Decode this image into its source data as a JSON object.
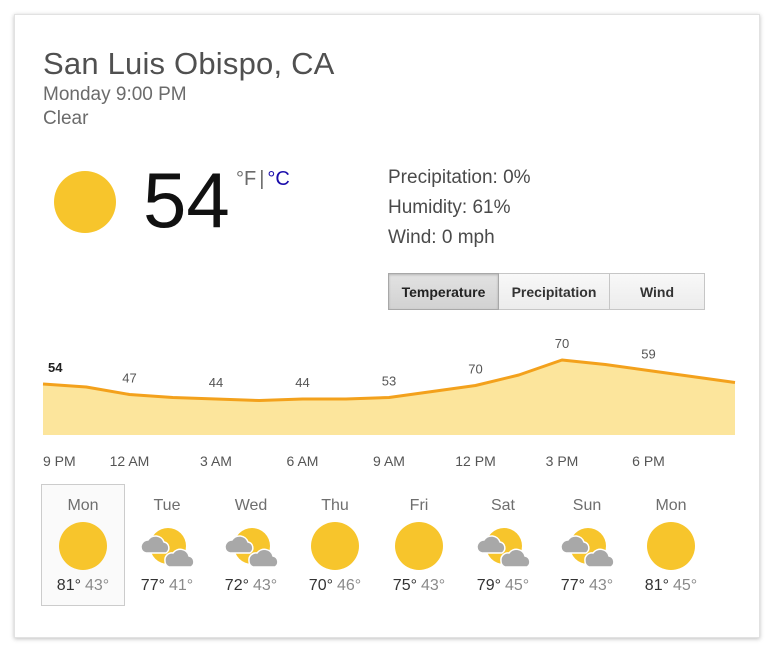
{
  "location": "San Luis Obispo, CA",
  "datetime": "Monday 9:00 PM",
  "condition": "Clear",
  "current": {
    "temp": "54",
    "unit_f": "°F",
    "unit_sep": "|",
    "unit_c": "°C",
    "icon": "sun-icon"
  },
  "details": {
    "precipitation": "Precipitation: 0%",
    "humidity": "Humidity: 61%",
    "wind": "Wind: 0 mph"
  },
  "tabs": [
    {
      "label": "Temperature",
      "active": true
    },
    {
      "label": "Precipitation",
      "active": false
    },
    {
      "label": "Wind",
      "active": false
    }
  ],
  "colors": {
    "line": "#f3a11c",
    "fill": "#fce59c",
    "sun": "#f7c52c",
    "cloud": "#a8a8a8",
    "link": "#1a0dab"
  },
  "chart_data": {
    "type": "area",
    "x": [
      "9 PM",
      "",
      "12 AM",
      "",
      "3 AM",
      "",
      "6 AM",
      "",
      "9 AM",
      "",
      "12 PM",
      "",
      "3 PM",
      "",
      "6 PM",
      "",
      ""
    ],
    "tick_labels": [
      "9 PM",
      "12 AM",
      "3 AM",
      "6 AM",
      "9 AM",
      "12 PM",
      "3 PM",
      "6 PM"
    ],
    "values": [
      54,
      52,
      47,
      45,
      44,
      43,
      44,
      44,
      45,
      49,
      53,
      60,
      70,
      67,
      63,
      59,
      55
    ],
    "labels": [
      "54",
      "47",
      "44",
      "44",
      "53",
      "70",
      "70",
      "59"
    ],
    "label_indices": [
      0,
      2,
      4,
      6,
      8,
      10,
      12,
      14
    ],
    "ylim": [
      20,
      80
    ]
  },
  "forecast": [
    {
      "day": "Mon",
      "hi": "81°",
      "lo": "43°",
      "icon": "sun-icon",
      "selected": true
    },
    {
      "day": "Tue",
      "hi": "77°",
      "lo": "41°",
      "icon": "partly-cloudy-icon",
      "selected": false
    },
    {
      "day": "Wed",
      "hi": "72°",
      "lo": "43°",
      "icon": "partly-cloudy-icon",
      "selected": false
    },
    {
      "day": "Thu",
      "hi": "70°",
      "lo": "46°",
      "icon": "sun-icon",
      "selected": false
    },
    {
      "day": "Fri",
      "hi": "75°",
      "lo": "43°",
      "icon": "sun-icon",
      "selected": false
    },
    {
      "day": "Sat",
      "hi": "79°",
      "lo": "45°",
      "icon": "partly-cloudy-icon",
      "selected": false
    },
    {
      "day": "Sun",
      "hi": "77°",
      "lo": "43°",
      "icon": "partly-cloudy-icon",
      "selected": false
    },
    {
      "day": "Mon",
      "hi": "81°",
      "lo": "45°",
      "icon": "sun-icon",
      "selected": false
    }
  ]
}
